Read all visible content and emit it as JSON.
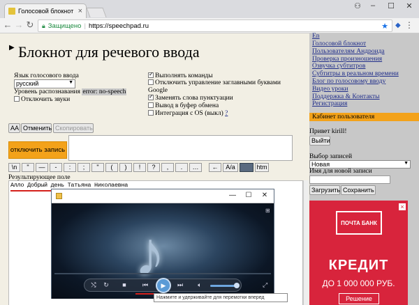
{
  "browser": {
    "tab_title": "Голосовой блокнот",
    "tab_close": "×",
    "secure_label": "Защищено",
    "separator": "|",
    "url": "https://speechpad.ru"
  },
  "page": {
    "title": "Блокнот для речевого ввода",
    "language_label": "Язык голосового ввода",
    "language_value": "русский",
    "recognition_label": "Уровень распознавания",
    "recognition_status": "error: no-speech",
    "disable_sounds": "Отключить звуки",
    "exec_commands": "Выполнять команды",
    "disable_caps": "Отключить управление заглавными буквами",
    "google_label": "Google",
    "replace_punct": "Заменять слова пунктуации",
    "clipboard_out": "Вывод в буфер обмена",
    "os_integration": "Интеграция с OS (выкл)",
    "os_help": "?",
    "aa_button": "АА",
    "undo_button": "Отменить",
    "copy_button": "Скопировать",
    "record_button": "отключить запись",
    "symbols": [
      "\\n",
      "\"",
      "—",
      "-",
      ":",
      ";",
      "\"",
      "(",
      ")",
      "!",
      "?",
      ",",
      ".",
      "…",
      "←",
      "А/а",
      "",
      "htm"
    ],
    "result_label": "Результирующее поле",
    "result_text": "Алло Добрый день Татьяна Николаевна"
  },
  "sidebar": {
    "top_link": "En",
    "links": [
      "Голосовой блокнот",
      "Пользователям Андроида",
      "Проверка произношения",
      "Озвучка субтитров",
      "Субтитры в реальном времени",
      "Блог по голосовому вводу",
      "Видео уроки",
      "Поддержка & Контакты",
      "Регистрация"
    ],
    "cabinet": "Кабинет пользователя",
    "greeting": "Привет kirill!",
    "logout": "Выйти",
    "records_label": "Выбор записей",
    "records_value": "Новая",
    "new_name_label": "Имя для новой записи",
    "load_button": "Загрузить",
    "save_button": "Сохранить"
  },
  "ad": {
    "logo": "ПОЧТА БАНК",
    "headline": "КРЕДИТ",
    "amount": "ДО 1 000 000 РУБ.",
    "cta": "Решение",
    "close": "×"
  },
  "player": {
    "minimize": "—",
    "maximize": "☐",
    "close": "✕",
    "tooltip": "Нажмите и удерживайте для перемотки вперед"
  }
}
